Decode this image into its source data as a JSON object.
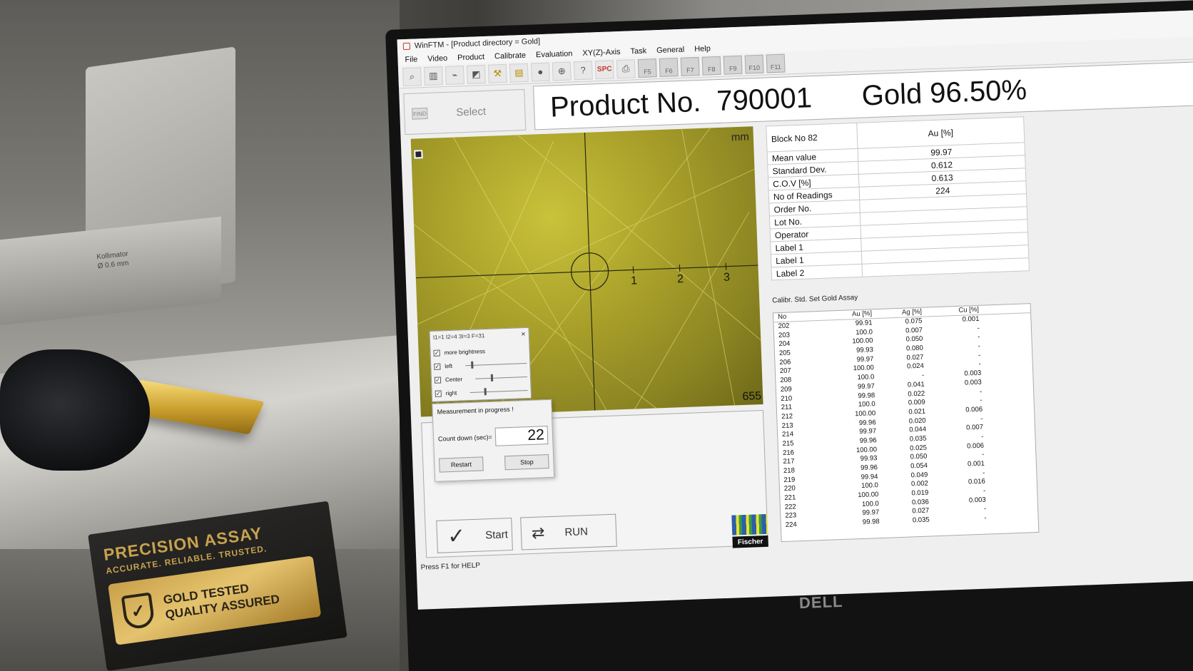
{
  "window": {
    "title": "WinFTM - [Product directory = Gold]"
  },
  "menu": [
    "File",
    "Video",
    "Product",
    "Calibrate",
    "Evaluation",
    "XY(Z)-Axis",
    "Task",
    "General",
    "Help"
  ],
  "toolbar": {
    "icons": [
      "magnifier-icon",
      "ruler-icon",
      "spectrum-icon",
      "chart-icon",
      "tool-icon",
      "open-book-icon",
      "dot-icon",
      "zoom-icon",
      "help-cursor-icon",
      "spc-icon",
      "printer-icon"
    ],
    "spc_label": "SPC",
    "fkeys": [
      "F5",
      "F6",
      "F7",
      "F8",
      "F9",
      "F10",
      "F11"
    ]
  },
  "select": {
    "label": "Select",
    "icon_text": "FIND"
  },
  "product": {
    "number_label": "Product No.",
    "number": "790001",
    "assay": "Gold 96.50%"
  },
  "video": {
    "unit": "mm",
    "ticks": [
      "1",
      "2",
      "3"
    ],
    "counter": "655"
  },
  "brightness_dialog": {
    "title": "I1=1 I2=4 3I=3 F=31",
    "options": [
      {
        "label": "more brightness",
        "checked": true
      },
      {
        "label": "left",
        "checked": true,
        "level": 0.1
      },
      {
        "label": "Center",
        "checked": true,
        "level": 0.3
      },
      {
        "label": "right",
        "checked": true,
        "level": 0.25
      }
    ]
  },
  "count_dialog": {
    "title": "Measurement in progress !",
    "label": "Count down (sec)=",
    "value": "22",
    "restart": "Restart",
    "stop": "Stop"
  },
  "buttons": {
    "start": "Start",
    "run": "RUN"
  },
  "logo": {
    "text": "Fischer"
  },
  "status": "Press F1 for HELP",
  "info": {
    "block": "Block No 82",
    "column": "Au [%]",
    "rows": [
      {
        "label": "Mean value",
        "value": "99.97"
      },
      {
        "label": "Standard Dev.",
        "value": "0.612"
      },
      {
        "label": "C.O.V [%]",
        "value": "0.613"
      },
      {
        "label": "No of Readings",
        "value": "224"
      },
      {
        "label": "Order No.",
        "value": ""
      },
      {
        "label": "Lot No.",
        "value": ""
      },
      {
        "label": "Operator",
        "value": ""
      },
      {
        "label": "Label 1",
        "value": ""
      },
      {
        "label": "Label 1",
        "value": ""
      },
      {
        "label": "Label 2",
        "value": ""
      }
    ]
  },
  "calibration": "Calibr. Std. Set Gold Assay",
  "readings": {
    "headers": [
      "No",
      "Au [%]",
      "Ag [%]",
      "Cu [%]"
    ],
    "rows": [
      [
        "202",
        "99.91",
        "0.075",
        "0.001"
      ],
      [
        "203",
        "100.0",
        "0.007",
        "-"
      ],
      [
        "204",
        "100.00",
        "0.050",
        "-"
      ],
      [
        "205",
        "99.93",
        "0.080",
        "-"
      ],
      [
        "206",
        "99.97",
        "0.027",
        "-"
      ],
      [
        "207",
        "100.00",
        "0.024",
        "-"
      ],
      [
        "208",
        "100.0",
        "-",
        "0.003"
      ],
      [
        "209",
        "99.97",
        "0.041",
        "0.003"
      ],
      [
        "210",
        "99.98",
        "0.022",
        "-"
      ],
      [
        "211",
        "100.0",
        "0.009",
        "-"
      ],
      [
        "212",
        "100.00",
        "0.021",
        "0.006"
      ],
      [
        "213",
        "99.96",
        "0.020",
        "-"
      ],
      [
        "214",
        "99.97",
        "0.044",
        "0.007"
      ],
      [
        "215",
        "99.96",
        "0.035",
        "-"
      ],
      [
        "216",
        "100.00",
        "0.025",
        "0.006"
      ],
      [
        "217",
        "99.93",
        "0.050",
        "-"
      ],
      [
        "218",
        "99.96",
        "0.054",
        "0.001"
      ],
      [
        "219",
        "99.94",
        "0.049",
        "-"
      ],
      [
        "220",
        "100.0",
        "0.002",
        "0.016"
      ],
      [
        "221",
        "100.00",
        "0.019",
        "-"
      ],
      [
        "222",
        "100.0",
        "0.036",
        "0.003"
      ],
      [
        "223",
        "99.97",
        "0.027",
        "-"
      ],
      [
        "224",
        "99.98",
        "0.035",
        "-"
      ]
    ]
  },
  "scene": {
    "collimator": "Kollimator",
    "collimator_size": "Ø 0.6 mm",
    "plaque_title": "PRECISION ASSAY",
    "plaque_sub": "ACCURATE. RELIABLE. TRUSTED.",
    "badge_line1": "GOLD TESTED",
    "badge_line2": "QUALITY ASSURED",
    "monitor_brand": "DELL"
  }
}
